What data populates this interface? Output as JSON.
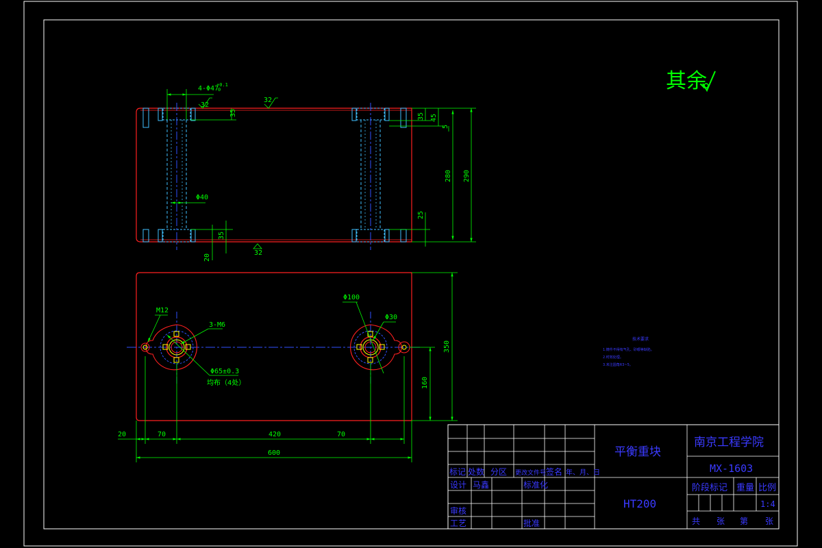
{
  "colors": {
    "background": "#000000",
    "border": "#ffffff",
    "part_outline": "#ff2020",
    "dimension": "#00ff00",
    "centerline": "#3050ff",
    "hidden": "#40c0ff",
    "title_text": "#3a3aff"
  },
  "roughness_note": "其余",
  "top_view": {
    "hole_spec": "4-Φ47",
    "hole_spec_sup": "+0.1",
    "hole_spec_sub": "0",
    "rough_top_left": "32",
    "rough_top_mid": "32",
    "rough_bottom": "32",
    "dim_35_top": "35",
    "dim_35_right": "35",
    "dim_45": "45",
    "dim_5": "5",
    "dim_280": "280",
    "dim_290": "290",
    "dim_25": "25",
    "dim_35_bottom": "35",
    "dim_20": "20",
    "phi40": "Φ40"
  },
  "front_view": {
    "m12": "M12",
    "m6": "3-M6",
    "phi65": "Φ65±0.3",
    "even": "均布（4处）",
    "phi100": "Φ100",
    "phi30": "Φ30",
    "dim_350": "350",
    "dim_160": "160",
    "dim_20": "20",
    "dim_70a": "70",
    "dim_420": "420",
    "dim_70b": "70",
    "dim_600": "600"
  },
  "tech_requirements": {
    "title": "技术要求",
    "lines": [
      "1.铸件不得有气孔、砂眼等缺陷。",
      "2.时效处理。",
      "3.未注圆角R3~5。"
    ]
  },
  "title_block": {
    "part_name": "平衡重块",
    "material": "HT200",
    "school": "南京工程学院",
    "drawing_no": "MX-1603",
    "row_labels": [
      "标记",
      "处数",
      "分区",
      "更改文件号",
      "签名",
      "年、月、日"
    ],
    "design_label": "设计",
    "designer": "马鑫",
    "standardize_label": "标准化",
    "review_label": "审核",
    "process_label": "工艺",
    "approve_label": "批准",
    "stage_label": "阶段标记",
    "weight_label": "重量",
    "scale_label": "比例",
    "scale_value": "1:4",
    "sheet_total_label": "共",
    "sheet_total_unit": "张",
    "sheet_no_label": "第",
    "sheet_no_unit": "张"
  }
}
